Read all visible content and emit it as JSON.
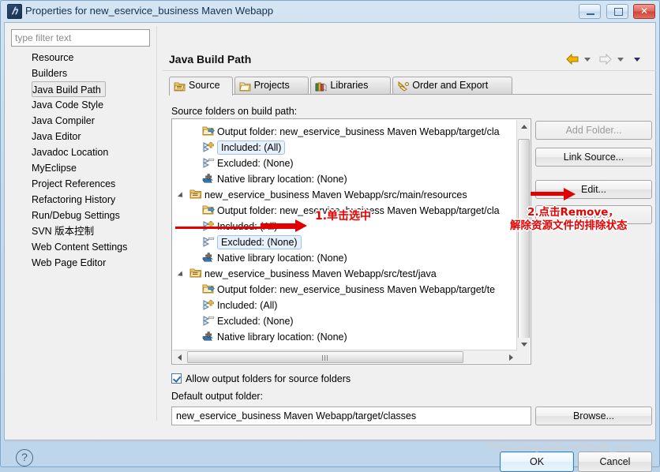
{
  "window": {
    "title": "Properties for new_eservice_business Maven Webapp",
    "icon": "eclipse-properties-icon",
    "controls": {
      "minimize": "minimize-button",
      "maximize": "maximize-button",
      "close": "✕"
    }
  },
  "filter": {
    "placeholder": "type filter text",
    "value": ""
  },
  "sidebar": {
    "items": [
      {
        "label": "Resource",
        "selected": false
      },
      {
        "label": "Builders",
        "selected": false
      },
      {
        "label": "Java Build Path",
        "selected": true
      },
      {
        "label": "Java Code Style",
        "selected": false
      },
      {
        "label": "Java Compiler",
        "selected": false
      },
      {
        "label": "Java Editor",
        "selected": false
      },
      {
        "label": "Javadoc Location",
        "selected": false
      },
      {
        "label": "MyEclipse",
        "selected": false
      },
      {
        "label": "Project References",
        "selected": false
      },
      {
        "label": "Refactoring History",
        "selected": false
      },
      {
        "label": "Run/Debug Settings",
        "selected": false
      },
      {
        "label": "SVN 版本控制",
        "selected": false
      },
      {
        "label": "Web Content Settings",
        "selected": false
      },
      {
        "label": "Web Page Editor",
        "selected": false
      }
    ]
  },
  "page": {
    "title": "Java Build Path",
    "nav": {
      "back": "back-arrow",
      "forward": "forward-arrow",
      "menu": "view-menu-caret"
    }
  },
  "tabs": [
    {
      "label": "Source",
      "icon": "source-folder-icon",
      "active": true
    },
    {
      "label": "Projects",
      "icon": "projects-folder-icon",
      "active": false
    },
    {
      "label": "Libraries",
      "icon": "libraries-books-icon",
      "active": false
    },
    {
      "label": "Order and Export",
      "icon": "order-export-icon",
      "active": false
    }
  ],
  "source_panel": {
    "list_label": "Source folders on build path:",
    "rows": [
      {
        "indent": 2,
        "icon": "output-folder-icon",
        "label": "Output folder: new_eservice_business Maven Webapp/target/cla",
        "selected": false,
        "expander": false
      },
      {
        "indent": 2,
        "icon": "include-filter-icon",
        "label": "Included: (All)",
        "selected": true,
        "expander": false
      },
      {
        "indent": 2,
        "icon": "exclude-filter-icon",
        "label": "Excluded: (None)",
        "selected": false,
        "expander": false
      },
      {
        "indent": 2,
        "icon": "native-library-icon",
        "label": "Native library location: (None)",
        "selected": false,
        "expander": false
      },
      {
        "indent": 1,
        "icon": "source-folder-icon",
        "label": "new_eservice_business Maven Webapp/src/main/resources",
        "selected": false,
        "expander": true
      },
      {
        "indent": 2,
        "icon": "output-folder-icon",
        "label": "Output folder: new_eservice_business Maven Webapp/target/cla",
        "selected": false,
        "expander": false
      },
      {
        "indent": 2,
        "icon": "include-filter-icon",
        "label": "Included: (All)",
        "selected": false,
        "expander": false
      },
      {
        "indent": 2,
        "icon": "exclude-filter-icon",
        "label": "Excluded: (None)",
        "selected": true,
        "expander": false
      },
      {
        "indent": 2,
        "icon": "native-library-icon",
        "label": "Native library location: (None)",
        "selected": false,
        "expander": false
      },
      {
        "indent": 1,
        "icon": "source-folder-icon",
        "label": "new_eservice_business Maven Webapp/src/test/java",
        "selected": false,
        "expander": true
      },
      {
        "indent": 2,
        "icon": "output-folder-icon",
        "label": "Output folder: new_eservice_business Maven Webapp/target/te",
        "selected": false,
        "expander": false
      },
      {
        "indent": 2,
        "icon": "include-filter-icon",
        "label": "Included: (All)",
        "selected": false,
        "expander": false
      },
      {
        "indent": 2,
        "icon": "exclude-filter-icon",
        "label": "Excluded: (None)",
        "selected": false,
        "expander": false
      },
      {
        "indent": 2,
        "icon": "native-library-icon",
        "label": "Native library location: (None)",
        "selected": false,
        "expander": false
      }
    ],
    "buttons": [
      {
        "label": "Add Folder...",
        "enabled": false
      },
      {
        "label": "Link Source...",
        "enabled": true
      },
      {
        "label": "Edit...",
        "enabled": true
      },
      {
        "label": "Remove",
        "enabled": false
      }
    ],
    "allow_output_label": "Allow output folders for source folders",
    "allow_output_checked": true,
    "default_output_label": "Default output folder:",
    "default_output_value": "new_eservice_business Maven Webapp/target/classes",
    "browse_label": "Browse..."
  },
  "footer": {
    "help": "?",
    "ok": "OK",
    "cancel": "Cancel"
  },
  "annotations": {
    "step1": "1.单击选中",
    "step2_line1": "2.点击Remove，",
    "step2_line2": "解除资源文件的排除状态"
  },
  "watermark": "https://blog.csdn.net/math_yan",
  "colors": {
    "accent": "#e60000",
    "selection": "#e8f1fb",
    "title": "#14314e"
  }
}
